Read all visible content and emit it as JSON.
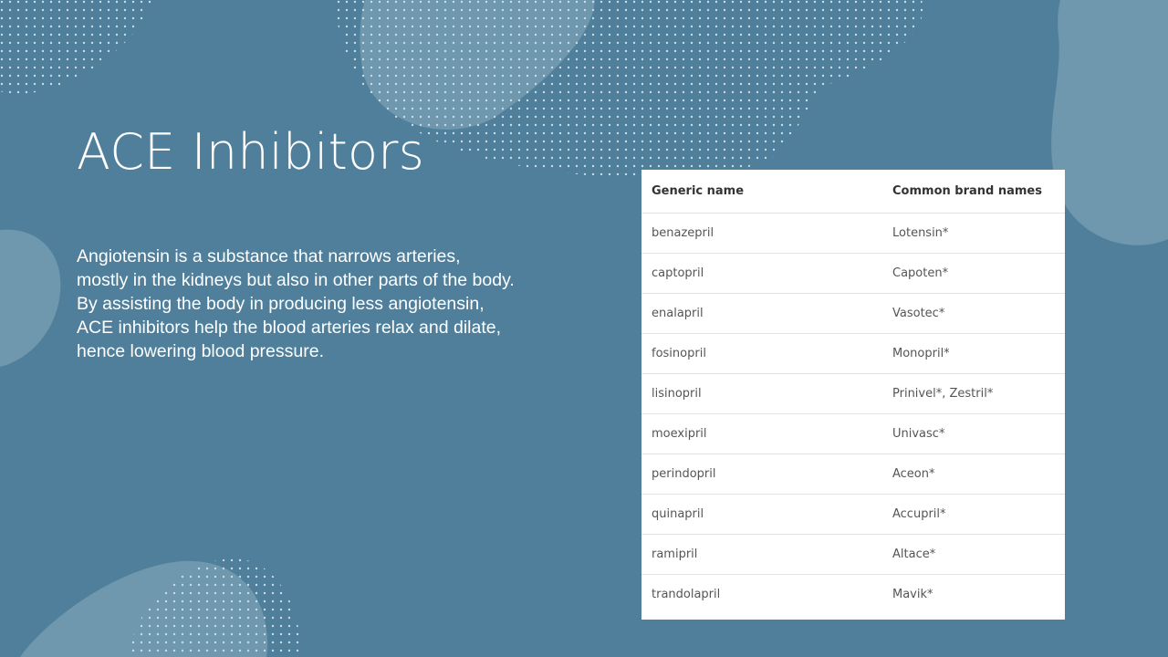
{
  "slide": {
    "title": "ACE Inhibitors",
    "body": "Angiotensin is a substance that narrows arteries, mostly in the kidneys but also in other parts of the body. By assisting the body in producing less angiotensin, ACE inhibitors help the blood arteries relax and dilate, hence lowering blood pressure.",
    "colors": {
      "background": "#4f7f9b",
      "blob": "#6f97ae",
      "dots": "#c9dce6",
      "text": "#ffffff",
      "table_background": "#ffffff"
    }
  },
  "table": {
    "headers": [
      "Generic name",
      "Common brand names"
    ],
    "rows": [
      [
        "benazepril",
        "Lotensin*"
      ],
      [
        "captopril",
        "Capoten*"
      ],
      [
        "enalapril",
        "Vasotec*"
      ],
      [
        "fosinopril",
        "Monopril*"
      ],
      [
        "lisinopril",
        "Prinivel*, Zestril*"
      ],
      [
        "moexipril",
        "Univasc*"
      ],
      [
        "perindopril",
        "Aceon*"
      ],
      [
        "quinapril",
        "Accupril*"
      ],
      [
        "ramipril",
        "Altace*"
      ],
      [
        "trandolapril",
        "Mavik*"
      ]
    ]
  }
}
